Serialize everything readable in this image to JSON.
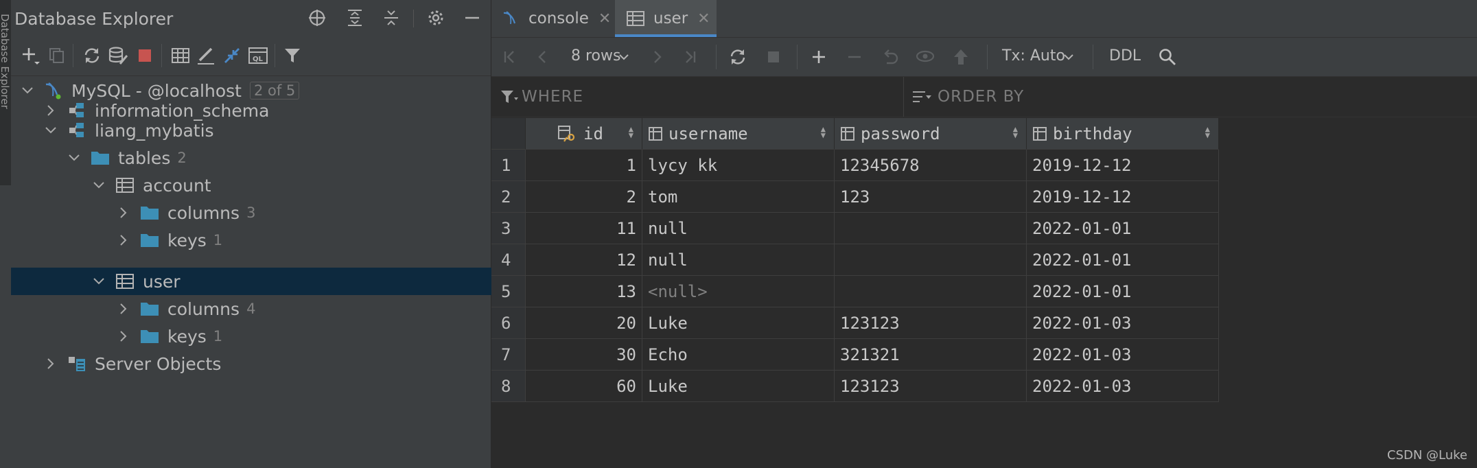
{
  "left_panel": {
    "title": "Database Explorer",
    "vertical_tab_label": "Database Explorer"
  },
  "tree": {
    "connection": {
      "label": "MySQL - @localhost",
      "badge": "2 of 5"
    },
    "schema1": {
      "label": "information_schema"
    },
    "schema2": {
      "label": "liang_mybatis"
    },
    "tables": {
      "label": "tables",
      "count": "2"
    },
    "account": {
      "label": "account"
    },
    "account_columns": {
      "label": "columns",
      "count": "3"
    },
    "account_keys": {
      "label": "keys",
      "count": "1"
    },
    "user": {
      "label": "user"
    },
    "user_columns": {
      "label": "columns",
      "count": "4"
    },
    "user_keys": {
      "label": "keys",
      "count": "1"
    },
    "server_objects": {
      "label": "Server Objects"
    }
  },
  "tabs": [
    {
      "label": "console",
      "icon": "mysql-console-icon"
    },
    {
      "label": "user",
      "icon": "table-icon"
    }
  ],
  "toolbar": {
    "rows_label": "8 rows",
    "tx_label": "Tx: Auto",
    "ddl_label": "DDL"
  },
  "filter": {
    "where_label": "WHERE",
    "order_label": "ORDER BY"
  },
  "grid": {
    "columns": [
      "id",
      "username",
      "password",
      "birthday"
    ],
    "rows": [
      {
        "n": "1",
        "id": "1",
        "username": "lycy kk",
        "password": "12345678",
        "birthday": "2019-12-12"
      },
      {
        "n": "2",
        "id": "2",
        "username": "tom",
        "password": "123",
        "birthday": "2019-12-12"
      },
      {
        "n": "3",
        "id": "11",
        "username": "null",
        "password": "",
        "birthday": "2022-01-01"
      },
      {
        "n": "4",
        "id": "12",
        "username": "null",
        "password": "",
        "birthday": "2022-01-01"
      },
      {
        "n": "5",
        "id": "13",
        "username": "<null>",
        "password": "",
        "birthday": "2022-01-01"
      },
      {
        "n": "6",
        "id": "20",
        "username": "Luke",
        "password": "123123",
        "birthday": "2022-01-03"
      },
      {
        "n": "7",
        "id": "30",
        "username": "Echo",
        "password": "321321",
        "birthday": "2022-01-03"
      },
      {
        "n": "8",
        "id": "60",
        "username": "Luke",
        "password": "123123",
        "birthday": "2022-01-03"
      }
    ]
  },
  "watermark": "CSDN @Luke",
  "colors": {
    "selection": "#0d293e",
    "accent": "#4a88c7",
    "folder": "#3d8fb6",
    "stop": "#c75450"
  }
}
